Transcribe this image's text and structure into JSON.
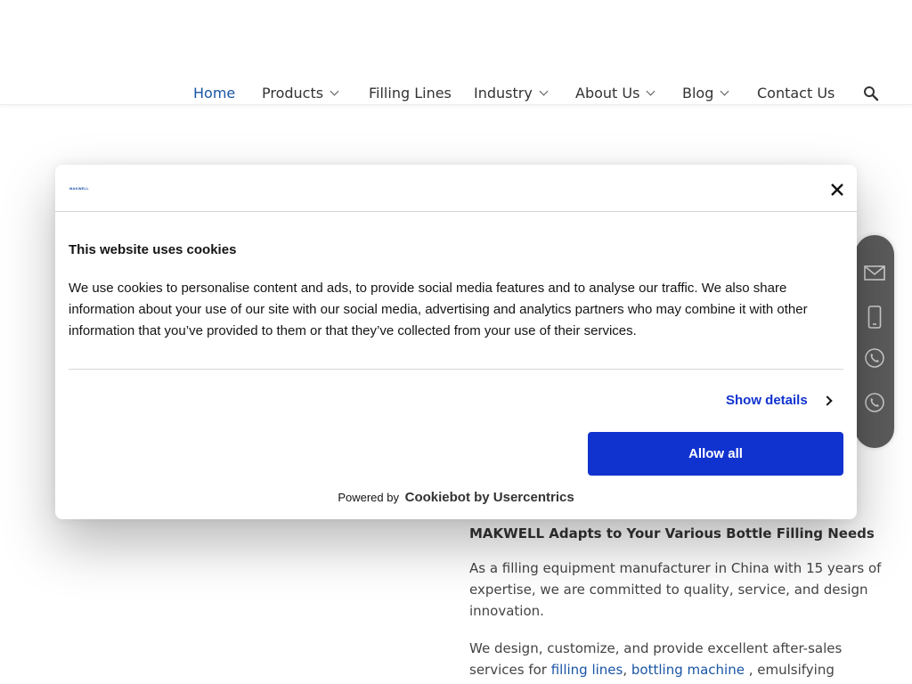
{
  "nav": {
    "items": [
      {
        "label": "Home"
      },
      {
        "label": "Products"
      },
      {
        "label": "Filling Lines"
      },
      {
        "label": "Industry"
      },
      {
        "label": "About Us"
      },
      {
        "label": "Blog"
      },
      {
        "label": "Contact Us"
      }
    ],
    "active_color": "#1a55a5"
  },
  "content": {
    "heading": "MAKWELL Adapts to Your Various Bottle Filling Needs",
    "para1": "As a filling equipment manufacturer in China with 15 years of expertise, we are committed to quality, service, and design innovation.",
    "para2_start": "We design, customize, and provide excellent after-sales services for ",
    "link1": "filling lines",
    "comma": ", ",
    "link2": "bottling machine",
    "para2_end": " , emulsifying"
  },
  "cookie": {
    "logo": "MAKWELL",
    "title": "This website uses cookies",
    "text": "We use cookies to personalise content and ads, to provide social media features and to analyse our traffic. We also share information about your use of our site with our social media, advertising and analytics partners who may combine it with other information that you’ve provided to them or that they’ve collected from your use of their services.",
    "show_details": "Show details",
    "allow_all": "Allow all",
    "powered_by": "Powered by",
    "brand": "Cookiebot by Usercentrics",
    "accent": "#1032cf"
  },
  "sidebar": {
    "icons": [
      "mail-icon",
      "mobile-phone-icon",
      "whatsapp-icon",
      "whatsapp-icon"
    ]
  }
}
